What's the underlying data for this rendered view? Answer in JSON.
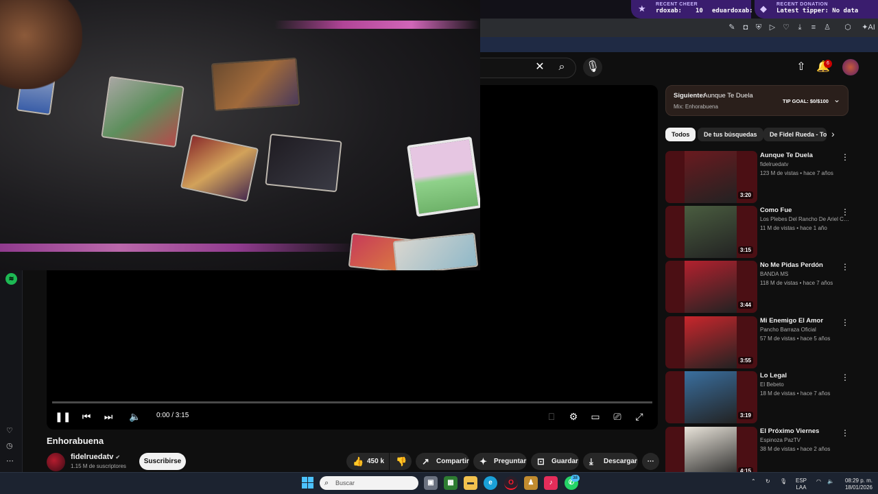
{
  "overlay": {
    "recent_cheer_label": "RECENT CHEER",
    "recent_cheer_user": "rdoxab:",
    "recent_cheer_amount": "10",
    "recent_cheer_user2": "eduardoxab:",
    "recent_donation_label": "RECENT DONATION",
    "latest_tipper": "Latest tipper: No data"
  },
  "header": {
    "search_value": "",
    "notification_count": "6"
  },
  "player": {
    "time_display": "0:00 / 3:15",
    "progress": 0
  },
  "video": {
    "title": "Enhorabuena",
    "channel_name": "fidelruedatv",
    "channel_subs": "1.15 M de suscriptores",
    "subscribe_label": "Suscribirse",
    "likes_label": "450 k",
    "share_label": "Compartir",
    "ask_label": "Preguntar",
    "save_label": "Guardar",
    "download_label": "Descargar"
  },
  "up_next": {
    "prefix": "Siguiente:",
    "title": "Aunque Te Duela",
    "mix": "Mix: Enhorabuena",
    "tip_goal": "TIP GOAL: $0/$100"
  },
  "chips": [
    "Todos",
    "De tus búsquedas",
    "De Fidel Rueda - To"
  ],
  "recommendations": [
    {
      "title": "Aunque Te Duela",
      "channel": "fidelruedatv",
      "meta": "123 M de vistas • hace 7 años",
      "duration": "3:20",
      "color": "#6a1a1f"
    },
    {
      "title": "Como Fue",
      "channel": "Los Plebes Del Rancho De Ariel Ca...",
      "meta": "11 M de vistas • hace 1 año",
      "duration": "3:15",
      "color": "#4a5d40"
    },
    {
      "title": "No Me Pidas Perdón",
      "channel": "BANDA MS",
      "meta": "118 M de vistas • hace 7 años",
      "duration": "3:44",
      "color": "#b3212e"
    },
    {
      "title": "Mi Enemigo El Amor",
      "channel": "Pancho Barraza Oficial",
      "meta": "57 M de vistas • hace 5 años",
      "duration": "3:55",
      "color": "#c9262c"
    },
    {
      "title": "Lo Legal",
      "channel": "El Bebeto",
      "meta": "18 M de vistas • hace 7 años",
      "duration": "3:19",
      "color": "#3a6f9f"
    },
    {
      "title": "El Próximo Viernes",
      "channel": "Espinoza PazTV",
      "meta": "38 M de vistas • hace 2 años",
      "duration": "4:15",
      "color": "#e9e4da"
    }
  ],
  "taskbar": {
    "search_placeholder": "Buscar",
    "lang": "ESP",
    "lang2": "LAA",
    "time": "08:29 p. m.",
    "date": "18/01/2026",
    "whatsapp_badge": "38"
  }
}
